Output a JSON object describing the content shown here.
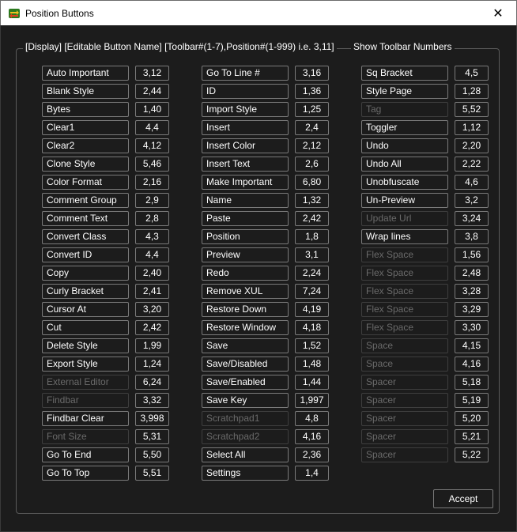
{
  "window": {
    "title": "Position Buttons"
  },
  "group_legend": "[Display] [Editable Button Name] [Toolbar#(1-7),Position#(1-999) i.e. 3,11]",
  "show_toolbar_numbers_label": "Show Toolbar Numbers",
  "accept_label": "Accept",
  "columns": [
    [
      {
        "name": "Auto Important",
        "pos": "3,12",
        "enabled": true
      },
      {
        "name": "Blank Style",
        "pos": "2,44",
        "enabled": true
      },
      {
        "name": "Bytes",
        "pos": "1,40",
        "enabled": true
      },
      {
        "name": "Clear1",
        "pos": "4,4",
        "enabled": true
      },
      {
        "name": "Clear2",
        "pos": "4,12",
        "enabled": true
      },
      {
        "name": "Clone Style",
        "pos": "5,46",
        "enabled": true
      },
      {
        "name": "Color Format",
        "pos": "2,16",
        "enabled": true
      },
      {
        "name": "Comment Group",
        "pos": "2,9",
        "enabled": true
      },
      {
        "name": "Comment Text",
        "pos": "2,8",
        "enabled": true
      },
      {
        "name": "Convert Class",
        "pos": "4,3",
        "enabled": true
      },
      {
        "name": "Convert ID",
        "pos": "4,4",
        "enabled": true
      },
      {
        "name": "Copy",
        "pos": "2,40",
        "enabled": true
      },
      {
        "name": "Curly Bracket",
        "pos": "2,41",
        "enabled": true
      },
      {
        "name": "Cursor At",
        "pos": "3,20",
        "enabled": true
      },
      {
        "name": "Cut",
        "pos": "2,42",
        "enabled": true
      },
      {
        "name": "Delete Style",
        "pos": "1,99",
        "enabled": true
      },
      {
        "name": "Export Style",
        "pos": "1,24",
        "enabled": true
      },
      {
        "name": "External Editor",
        "pos": "6,24",
        "enabled": false
      },
      {
        "name": "Findbar",
        "pos": "3,32",
        "enabled": false
      },
      {
        "name": "Findbar Clear",
        "pos": "3,998",
        "enabled": true
      },
      {
        "name": "Font Size",
        "pos": "5,31",
        "enabled": false
      },
      {
        "name": "Go To End",
        "pos": "5,50",
        "enabled": true
      },
      {
        "name": "Go To Top",
        "pos": "5,51",
        "enabled": true
      }
    ],
    [
      {
        "name": "Go To Line #",
        "pos": "3,16",
        "enabled": true
      },
      {
        "name": "ID",
        "pos": "1,36",
        "enabled": true
      },
      {
        "name": "Import Style",
        "pos": "1,25",
        "enabled": true
      },
      {
        "name": "Insert",
        "pos": "2,4",
        "enabled": true
      },
      {
        "name": "Insert Color",
        "pos": "2,12",
        "enabled": true
      },
      {
        "name": "Insert Text",
        "pos": "2,6",
        "enabled": true
      },
      {
        "name": "Make Important",
        "pos": "6,80",
        "enabled": true
      },
      {
        "name": "Name",
        "pos": "1,32",
        "enabled": true
      },
      {
        "name": "Paste",
        "pos": "2,42",
        "enabled": true
      },
      {
        "name": "Position",
        "pos": "1,8",
        "enabled": true
      },
      {
        "name": "Preview",
        "pos": "3,1",
        "enabled": true
      },
      {
        "name": "Redo",
        "pos": "2,24",
        "enabled": true
      },
      {
        "name": "Remove XUL",
        "pos": "7,24",
        "enabled": true
      },
      {
        "name": "Restore Down",
        "pos": "4,19",
        "enabled": true
      },
      {
        "name": "Restore Window",
        "pos": "4,18",
        "enabled": true
      },
      {
        "name": "Save",
        "pos": "1,52",
        "enabled": true
      },
      {
        "name": "Save/Disabled",
        "pos": "1,48",
        "enabled": true
      },
      {
        "name": "Save/Enabled",
        "pos": "1,44",
        "enabled": true
      },
      {
        "name": "Save Key",
        "pos": "1,997",
        "enabled": true
      },
      {
        "name": "Scratchpad1",
        "pos": "4,8",
        "enabled": false
      },
      {
        "name": "Scratchpad2",
        "pos": "4,16",
        "enabled": false
      },
      {
        "name": "Select All",
        "pos": "2,36",
        "enabled": true
      },
      {
        "name": "Settings",
        "pos": "1,4",
        "enabled": true
      }
    ],
    [
      {
        "name": "Sq Bracket",
        "pos": "4,5",
        "enabled": true
      },
      {
        "name": "Style Page",
        "pos": "1,28",
        "enabled": true
      },
      {
        "name": "Tag",
        "pos": "5,52",
        "enabled": false
      },
      {
        "name": "Toggler",
        "pos": "1,12",
        "enabled": true
      },
      {
        "name": "Undo",
        "pos": "2,20",
        "enabled": true
      },
      {
        "name": "Undo All",
        "pos": "2,22",
        "enabled": true
      },
      {
        "name": "Unobfuscate",
        "pos": "4,6",
        "enabled": true
      },
      {
        "name": "Un-Preview",
        "pos": "3,2",
        "enabled": true
      },
      {
        "name": "Update Url",
        "pos": "3,24",
        "enabled": false
      },
      {
        "name": "Wrap lines",
        "pos": "3,8",
        "enabled": true
      },
      {
        "name": "Flex Space",
        "pos": "1,56",
        "enabled": false
      },
      {
        "name": "Flex Space",
        "pos": "2,48",
        "enabled": false
      },
      {
        "name": "Flex Space",
        "pos": "3,28",
        "enabled": false
      },
      {
        "name": "Flex Space",
        "pos": "3,29",
        "enabled": false
      },
      {
        "name": "Flex Space",
        "pos": "3,30",
        "enabled": false
      },
      {
        "name": "Space",
        "pos": "4,15",
        "enabled": false
      },
      {
        "name": "Space",
        "pos": "4,16",
        "enabled": false
      },
      {
        "name": "Spacer",
        "pos": "5,18",
        "enabled": false
      },
      {
        "name": "Spacer",
        "pos": "5,19",
        "enabled": false
      },
      {
        "name": "Spacer",
        "pos": "5,20",
        "enabled": false
      },
      {
        "name": "Spacer",
        "pos": "5,21",
        "enabled": false
      },
      {
        "name": "Spacer",
        "pos": "5,22",
        "enabled": false
      }
    ]
  ],
  "colors": {
    "background": "#1c1c1c",
    "border": "#7a7a7a",
    "disabled_text": "#6a6a6a",
    "text": "#ffffff"
  },
  "icons": {
    "app": "app-swap-icon",
    "close": "close-icon"
  }
}
